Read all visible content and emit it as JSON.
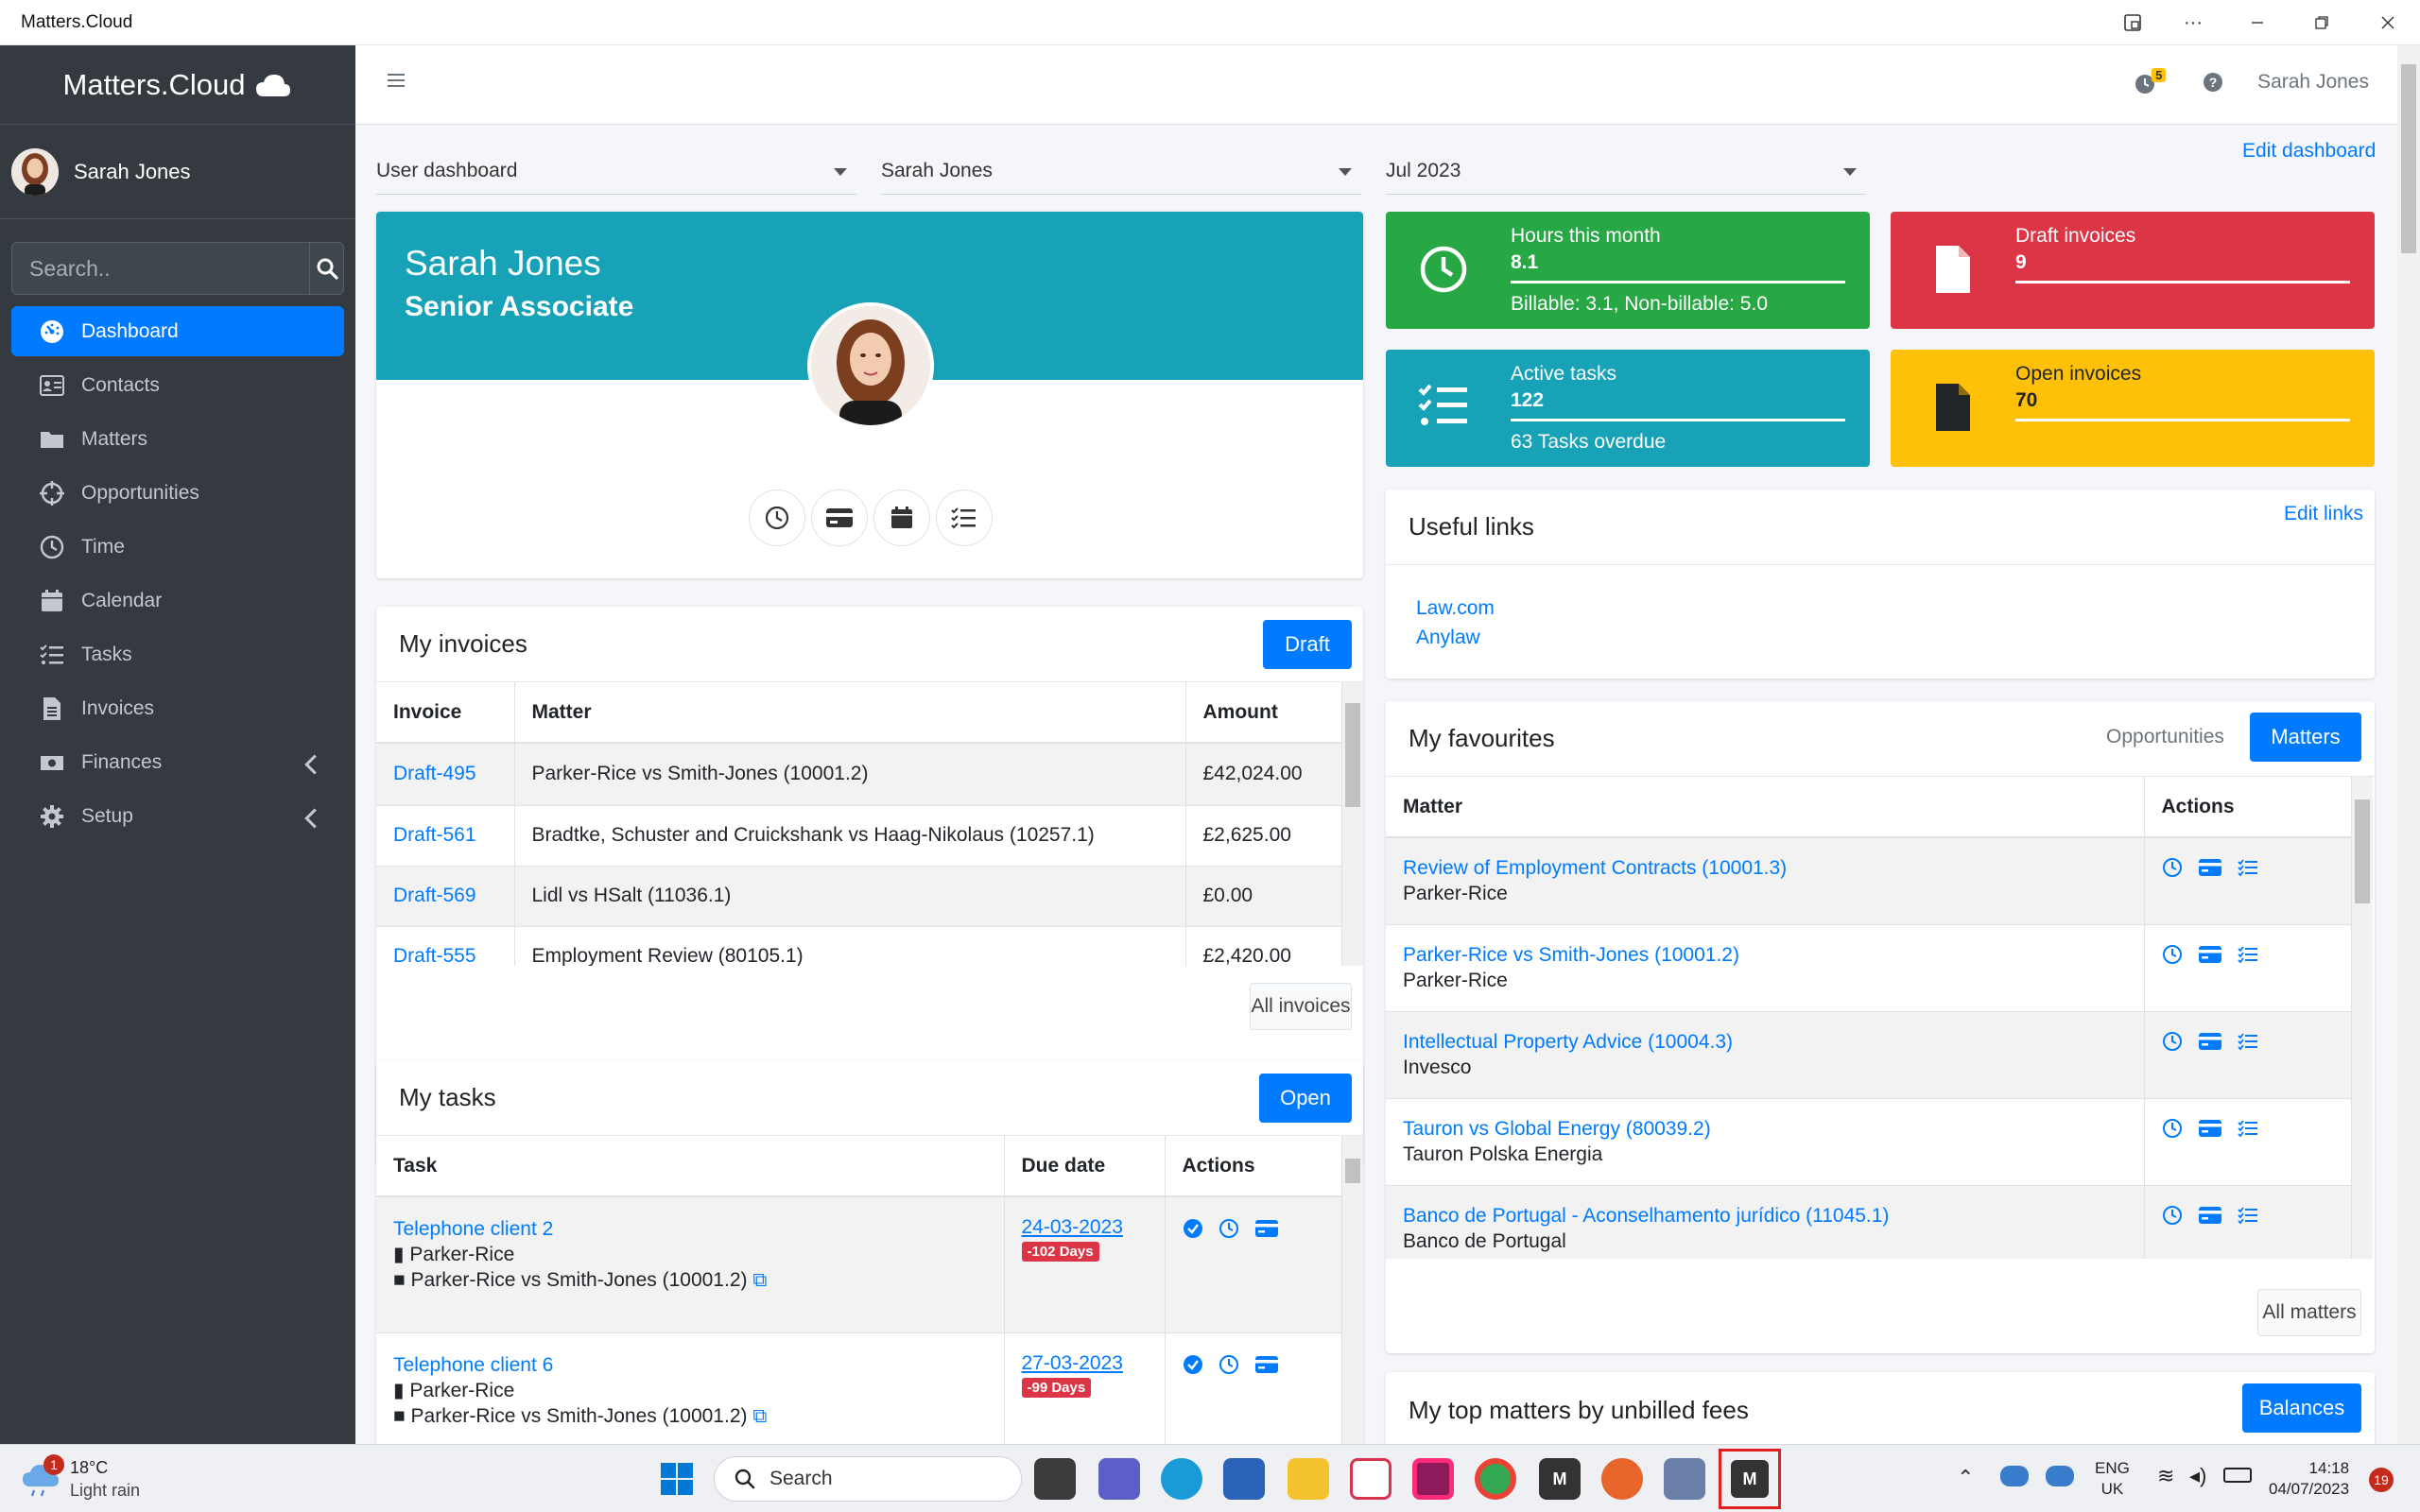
{
  "window": {
    "title": "Matters.Cloud"
  },
  "sidebar": {
    "brand": "Matters.Cloud",
    "user": "Sarah Jones",
    "search_placeholder": "Search..",
    "items": [
      {
        "label": "Dashboard",
        "icon": "dashboard-icon"
      },
      {
        "label": "Contacts",
        "icon": "contacts-icon"
      },
      {
        "label": "Matters",
        "icon": "folder-icon"
      },
      {
        "label": "Opportunities",
        "icon": "crosshair-icon"
      },
      {
        "label": "Time",
        "icon": "clock-icon"
      },
      {
        "label": "Calendar",
        "icon": "calendar-icon"
      },
      {
        "label": "Tasks",
        "icon": "tasks-icon"
      },
      {
        "label": "Invoices",
        "icon": "invoice-icon"
      },
      {
        "label": "Finances",
        "icon": "money-icon"
      },
      {
        "label": "Setup",
        "icon": "gear-icon"
      }
    ]
  },
  "topnav": {
    "notif_count": "5",
    "user": "Sarah Jones"
  },
  "filters": {
    "dashboard": "User dashboard",
    "user": "Sarah Jones",
    "month": "Jul 2023",
    "edit_dashboard": "Edit dashboard"
  },
  "profile": {
    "name": "Sarah Jones",
    "title": "Senior Associate"
  },
  "stats": {
    "hours": {
      "label": "Hours this month",
      "value": "8.1",
      "sub": "Billable: 3.1, Non-billable: 5.0",
      "color": "#28a745"
    },
    "draft": {
      "label": "Draft invoices",
      "value": "9",
      "color": "#dc3545"
    },
    "tasks": {
      "label": "Active tasks",
      "value": "122",
      "sub": "63 Tasks overdue",
      "color": "#17a2b8"
    },
    "open": {
      "label": "Open invoices",
      "value": "70",
      "color": "#ffc107"
    }
  },
  "useful_links": {
    "title": "Useful links",
    "edit": "Edit links",
    "links": [
      "Law.com",
      "Anylaw"
    ]
  },
  "invoices": {
    "title": "My invoices",
    "button": "Draft",
    "headers": [
      "Invoice",
      "Matter",
      "Amount"
    ],
    "rows": [
      {
        "id": "Draft-495",
        "matter": "Parker-Rice vs Smith-Jones (10001.2)",
        "amount": "£42,024.00"
      },
      {
        "id": "Draft-561",
        "matter": "Bradtke, Schuster and Cruickshank vs Haag-Nikolaus (10257.1)",
        "amount": "£2,625.00"
      },
      {
        "id": "Draft-569",
        "matter": "Lidl vs HSalt (11036.1)",
        "amount": "£0.00"
      },
      {
        "id": "Draft-555",
        "matter": "Employment Review (80105.1)",
        "amount": "£2,420.00"
      }
    ],
    "all": "All invoices"
  },
  "tasks": {
    "title": "My tasks",
    "button": "Open",
    "headers": [
      "Task",
      "Due date",
      "Actions"
    ],
    "rows": [
      {
        "task": "Telephone client 2",
        "client": "Parker-Rice",
        "matter": "Parker-Rice vs Smith-Jones (10001.2)",
        "due": "24-03-2023",
        "overdue": "-102 Days"
      },
      {
        "task": "Telephone client 6",
        "client": "Parker-Rice",
        "matter": "Parker-Rice vs Smith-Jones (10001.2)",
        "due": "27-03-2023",
        "overdue": "-99 Days"
      }
    ]
  },
  "favourites": {
    "title": "My favourites",
    "tab_opps": "Opportunities",
    "tab_matters": "Matters",
    "headers": [
      "Matter",
      "Actions"
    ],
    "rows": [
      {
        "matter": "Review of Employment Contracts (10001.3)",
        "client": "Parker-Rice"
      },
      {
        "matter": "Parker-Rice vs Smith-Jones (10001.2)",
        "client": "Parker-Rice"
      },
      {
        "matter": "Intellectual Property Advice (10004.3)",
        "client": "Invesco"
      },
      {
        "matter": "Tauron vs Global Energy (80039.2)",
        "client": "Tauron Polska Energia"
      },
      {
        "matter": "Banco de Portugal - Aconselhamento jurídico (11045.1)",
        "client": "Banco de Portugal"
      }
    ],
    "all": "All matters"
  },
  "top_matters": {
    "title": "My top matters by unbilled fees",
    "button": "Balances"
  },
  "taskbar": {
    "weather_temp": "18°C",
    "weather_desc": "Light rain",
    "weather_badge": "1",
    "search": "Search",
    "lang1": "ENG",
    "lang2": "UK",
    "time": "14:18",
    "date": "04/07/2023",
    "notif": "19",
    "app_m": "M"
  }
}
